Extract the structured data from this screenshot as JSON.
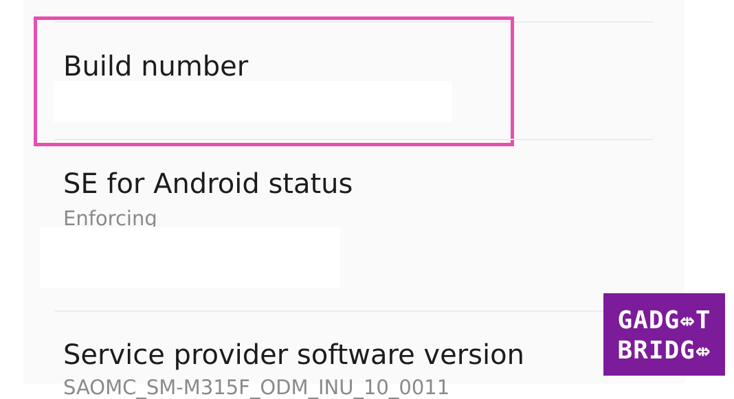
{
  "settings": {
    "rows": [
      {
        "title": "Build number",
        "subtitle": ""
      },
      {
        "title": "SE for Android status",
        "subtitle": "Enforcing"
      },
      {
        "title": "Service provider software version",
        "subtitle": "SAOMC_SM-M315F_ODM_INU_10_0011"
      }
    ]
  },
  "highlight": {
    "color": "#e64fae"
  },
  "watermark": {
    "line1": "GADG⇎T",
    "line2": "BRIDG⇎",
    "color": "#7c1c9a"
  }
}
